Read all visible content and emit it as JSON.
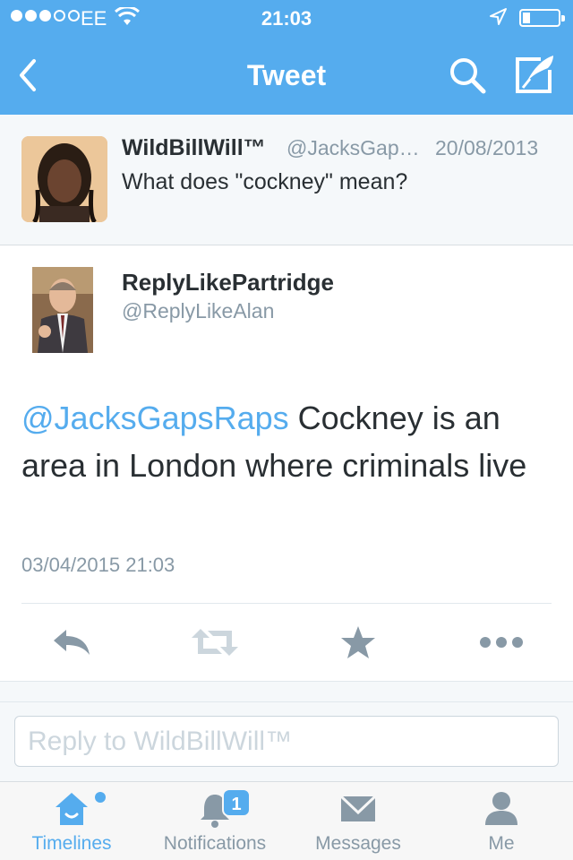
{
  "status_bar": {
    "carrier": "EE",
    "time": "21:03",
    "battery_level": 0.2,
    "signal_bars": 3,
    "signal_total": 5
  },
  "nav": {
    "title": "Tweet",
    "back_icon": "chevron-left-icon",
    "search_icon": "search-icon",
    "compose_icon": "compose-tweet-icon"
  },
  "parent_tweet": {
    "name": "WildBillWill™",
    "handle": "@JacksGap…",
    "date": "20/08/2013",
    "text": "What does \"cockney\" mean?"
  },
  "main_tweet": {
    "name": "ReplyLikePartridge",
    "handle": "@ReplyLikeAlan",
    "mention": "@JacksGapsRaps",
    "text": " Cockney is an area in London where criminals live",
    "timestamp": "03/04/2015 21:03"
  },
  "actions": [
    "reply-icon",
    "retweet-icon",
    "favorite-icon",
    "more-icon"
  ],
  "reply": {
    "placeholder": "Reply to WildBillWill™"
  },
  "tabs": [
    {
      "label": "Timelines",
      "icon": "home-icon",
      "active": true
    },
    {
      "label": "Notifications",
      "icon": "bell-icon",
      "badge": "1"
    },
    {
      "label": "Messages",
      "icon": "envelope-icon"
    },
    {
      "label": "Me",
      "icon": "person-icon"
    }
  ],
  "colors": {
    "accent": "#55acee",
    "text": "#292f33",
    "muted": "#8899a6",
    "icon_gray": "#8899a6"
  }
}
